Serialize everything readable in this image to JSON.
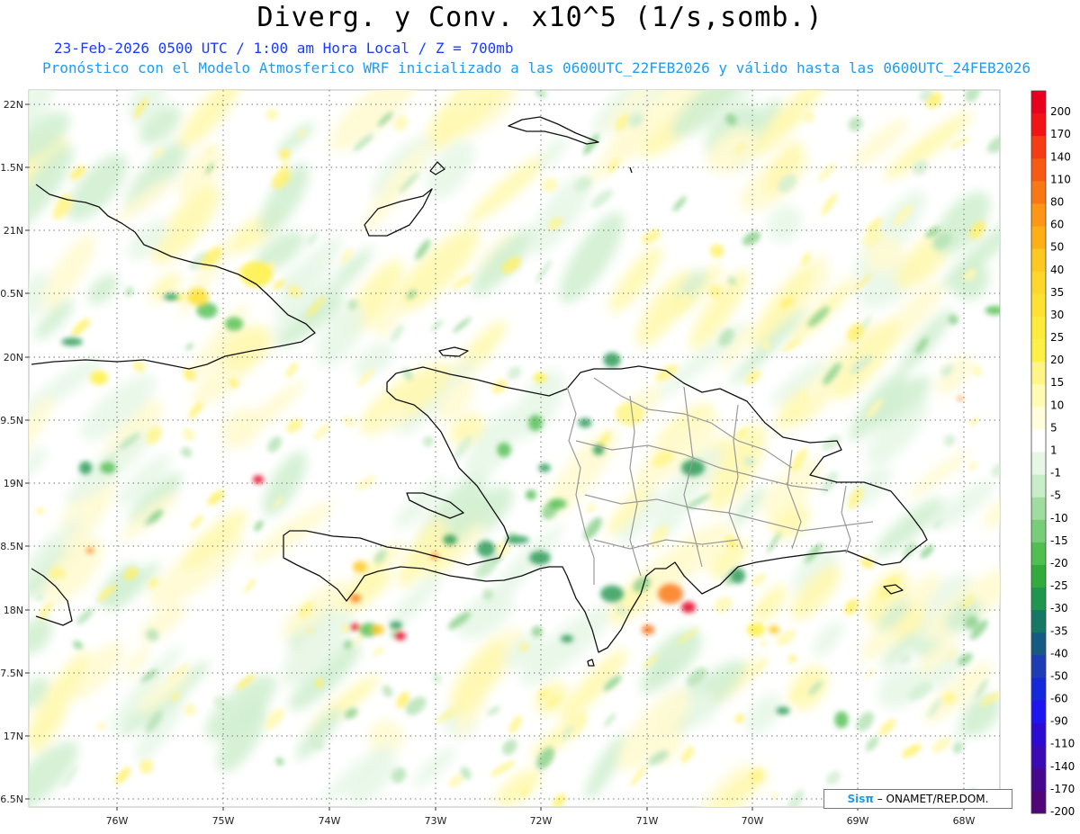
{
  "header": {
    "title": "Diverg. y Conv. x10^5 (1/s,somb.)",
    "subtitle1": "23-Feb-2026  0500 UTC / 1:00 am Hora Local / Z = 700mb",
    "subtitle2": "Pronóstico con el Modelo Atmosferico WRF inicializado a las 0600UTC_22FEB2026 y válido hasta las  0600UTC_24FEB2026"
  },
  "map": {
    "lat_labels": [
      "22N",
      "1.5N",
      "21N",
      "0.5N",
      "20N",
      "9.5N",
      "19N",
      "8.5N",
      "18N",
      "7.5N",
      "17N",
      "6.5N"
    ],
    "lon_labels": [
      "76W",
      "75W",
      "74W",
      "73W",
      "72W",
      "71W",
      "70W",
      "69W",
      "68W"
    ],
    "gridlines": true,
    "field": "divergence/convergence shading at 700mb",
    "region": "Hispaniola, eastern Cuba, southern Bahamas"
  },
  "colorbar": {
    "levels": [
      {
        "label": "200",
        "color": "#e8001e"
      },
      {
        "label": "170",
        "color": "#f01414"
      },
      {
        "label": "140",
        "color": "#f53c14"
      },
      {
        "label": "110",
        "color": "#f75a14"
      },
      {
        "label": "80",
        "color": "#fa7814"
      },
      {
        "label": "60",
        "color": "#fc9614"
      },
      {
        "label": "50",
        "color": "#fdaf14"
      },
      {
        "label": "40",
        "color": "#fec81e"
      },
      {
        "label": "35",
        "color": "#ffd728"
      },
      {
        "label": "30",
        "color": "#ffe132"
      },
      {
        "label": "25",
        "color": "#ffeb3c"
      },
      {
        "label": "20",
        "color": "#fff046"
      },
      {
        "label": "15",
        "color": "#fff587"
      },
      {
        "label": "10",
        "color": "#fffab4"
      },
      {
        "label": "5",
        "color": "#fffddc"
      },
      {
        "label": "1",
        "color": "#ffffff"
      },
      {
        "label": "-1",
        "color": "#e6f7e6"
      },
      {
        "label": "-5",
        "color": "#c8edc8"
      },
      {
        "label": "-10",
        "color": "#a0dca0"
      },
      {
        "label": "-15",
        "color": "#78cd78"
      },
      {
        "label": "-20",
        "color": "#50be50"
      },
      {
        "label": "-25",
        "color": "#32aa3c"
      },
      {
        "label": "-30",
        "color": "#1e9650"
      },
      {
        "label": "-35",
        "color": "#147864"
      },
      {
        "label": "-40",
        "color": "#145a82"
      },
      {
        "label": "-50",
        "color": "#1e3cb4"
      },
      {
        "label": "-60",
        "color": "#1428dc"
      },
      {
        "label": "-90",
        "color": "#1e14f0"
      },
      {
        "label": "-110",
        "color": "#2d0ad2"
      },
      {
        "label": "-140",
        "color": "#3c0ab4"
      },
      {
        "label": "-170",
        "color": "#46088c"
      },
      {
        "label": "-200",
        "color": "#500678"
      }
    ]
  },
  "credit": {
    "brand": "Sisπ",
    "text": " – ONAMET/REP.DOM."
  },
  "colors": {
    "subtitle1": "#1a3cff",
    "subtitle2": "#1e9cf0",
    "land_outline": "#111111",
    "province_lines": "#999999"
  }
}
